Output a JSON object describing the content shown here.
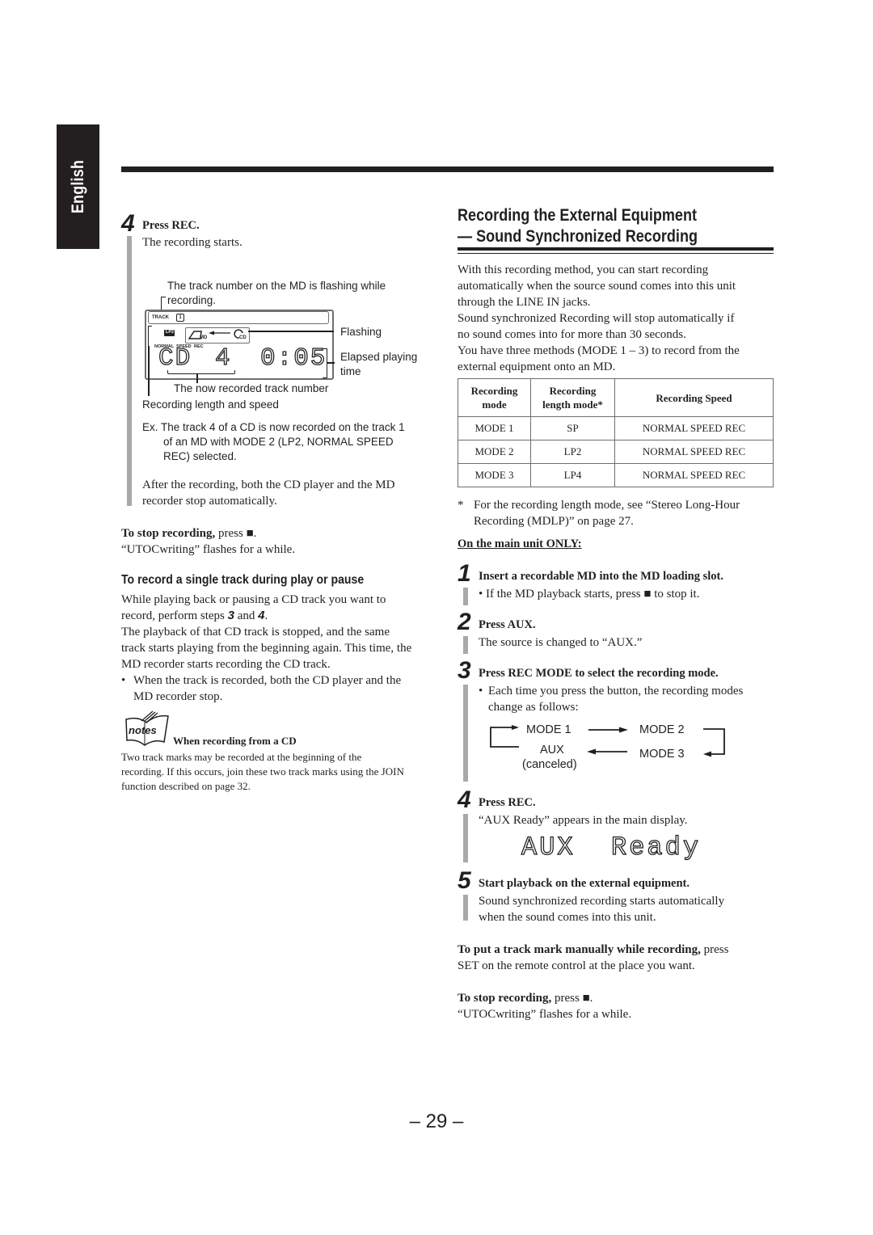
{
  "language_tab": "English",
  "page_number": "– 29 –",
  "left": {
    "step4": {
      "num": "4",
      "title": "Press REC.",
      "text": "The recording starts."
    },
    "display_callouts": {
      "track_flashing": "The track number on the MD is flashing while",
      "track_flashing_2": "recording.",
      "flashing": "Flashing",
      "elapsed_1": "Elapsed playing",
      "elapsed_2": "time",
      "now_recorded": "The now recorded track number",
      "length_speed": "Recording length and speed"
    },
    "lcd": {
      "track_label": "TRACK",
      "track_num": "1",
      "lp2": "LP2",
      "md": "MD",
      "cd": "CD",
      "normal": "NORMAL",
      "speed": "SPEED",
      "rec": "REC",
      "source": "CD",
      "track": "4",
      "time": "0:05"
    },
    "example": {
      "line1": "Ex. The track 4 of a CD is now recorded on the track 1",
      "line2": "of an MD with MODE 2 (LP2, NORMAL SPEED",
      "line3": "REC) selected."
    },
    "after_1": "After the recording, both the CD player and the MD",
    "after_2": "recorder stop automatically.",
    "stop": {
      "bold": "To stop recording,",
      "rest": " press ■.",
      "line2": "“UTOCwriting” flashes for a while."
    },
    "single_track": {
      "heading": "To record a single track during play or pause",
      "l1": "While playing back or pausing a CD track you want to",
      "l2a": "record, perform steps ",
      "l2b": "3",
      "l2c": " and ",
      "l2d": "4",
      "l2e": ".",
      "l3": "The playback of that CD track is stopped, and the same",
      "l4": "track starts playing from the beginning again. This time, the",
      "l5": "MD recorder starts recording the CD track.",
      "bullet1": "When the track is recorded, both the CD player and the",
      "bullet2": "MD recorder stop."
    },
    "notes": {
      "icon_label": "notes",
      "heading": "When recording from a CD",
      "l1": "Two track marks may be recorded at the beginning of the",
      "l2": "recording. If this occurs, join these two track marks using the JOIN",
      "l3": "function described on page 32."
    }
  },
  "right": {
    "title_1": "Recording the External Equipment",
    "title_2": "— Sound Synchronized Recording",
    "intro": [
      "With this recording method, you can start recording",
      "automatically when the source sound comes into this unit",
      "through the LINE IN jacks.",
      "Sound synchronized Recording will stop automatically if",
      "no sound comes into for more than 30 seconds.",
      "You have three methods (MODE 1 – 3) to record from the",
      "external equipment onto an MD."
    ],
    "table": {
      "headers": [
        [
          "Recording",
          "mode"
        ],
        [
          "Recording",
          "length mode*"
        ],
        [
          "Recording Speed"
        ]
      ],
      "rows": [
        [
          "MODE 1",
          "SP",
          "NORMAL SPEED REC"
        ],
        [
          "MODE 2",
          "LP2",
          "NORMAL SPEED REC"
        ],
        [
          "MODE 3",
          "LP4",
          "NORMAL SPEED REC"
        ]
      ]
    },
    "footnote_1": "For the recording length mode, see “Stereo Long-Hour",
    "footnote_2": "Recording (MDLP)” on page 27.",
    "footnote_mark": "*",
    "main_unit_only": "On the main unit ONLY:",
    "steps": [
      {
        "num": "1",
        "title": "Insert a recordable MD into the MD loading slot.",
        "text": "If the MD playback starts, press ■ to stop it."
      },
      {
        "num": "2",
        "title": "Press AUX.",
        "text": "The source is changed to “AUX.”"
      },
      {
        "num": "3",
        "title": "Press REC MODE to select the recording mode.",
        "text1": "Each time you press the button, the recording modes",
        "text2": "change as follows:"
      },
      {
        "num": "4",
        "title": "Press REC.",
        "text": "“AUX Ready” appears in the main display."
      },
      {
        "num": "5",
        "title": "Start playback on the external equipment.",
        "text1": "Sound synchronized recording starts automatically",
        "text2": "when the sound comes into this unit."
      }
    ],
    "flow": {
      "mode1": "MODE 1",
      "mode2": "MODE 2",
      "mode3": "MODE 3",
      "aux": "AUX",
      "canceled": "(canceled)"
    },
    "aux_display": "AUX  Ready",
    "track_mark": {
      "bold": "To put a track mark manually while recording,",
      "rest": " press",
      "line2": "SET on the remote control at the place you want."
    },
    "stop": {
      "bold": "To stop recording,",
      "rest": " press ■.",
      "line2": "“UTOCwriting” flashes for a while."
    }
  }
}
